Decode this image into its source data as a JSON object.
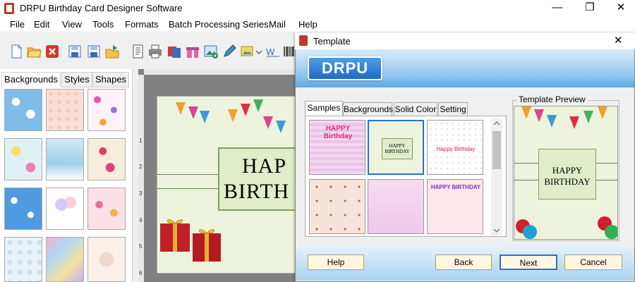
{
  "app": {
    "title": "DRPU Birthday Card Designer Software",
    "window_controls": [
      "—",
      "❐",
      "✕"
    ]
  },
  "menu": [
    "File",
    "Edit",
    "View",
    "Tools",
    "Formats",
    "Batch Processing Series",
    "Mail",
    "Help"
  ],
  "left_panel": {
    "tabs": [
      "Backgrounds",
      "Styles",
      "Shapes"
    ],
    "active_tab": "Backgrounds"
  },
  "ruler": {
    "numbers": [
      "1",
      "2",
      "3",
      "4",
      "5",
      "6"
    ]
  },
  "card": {
    "line1": "HAP",
    "line2": "BIRTH"
  },
  "dialog": {
    "title": "Template",
    "close": "✕",
    "logo": "DRPU",
    "tabs": [
      "Samples",
      "Backgrounds",
      "Solid Color",
      "Setting"
    ],
    "active_tab": "Samples",
    "thumbnails": [
      {
        "text": "HAPPY Birthday"
      },
      {
        "text": "HAPPY BIRTHDAY"
      },
      {
        "text": "Happy Birthday"
      },
      {
        "text": ""
      },
      {
        "text": ""
      },
      {
        "text": "HAPPY BIRTHDAY"
      }
    ],
    "preview": {
      "label": "Template Preview",
      "text": "HAPPY BIRTHDAY"
    },
    "buttons": {
      "help": "Help",
      "back": "Back",
      "next": "Next",
      "cancel": "Cancel"
    }
  },
  "colors": {
    "accent": "#2a6fd6",
    "banner": "#5aa6e0"
  }
}
